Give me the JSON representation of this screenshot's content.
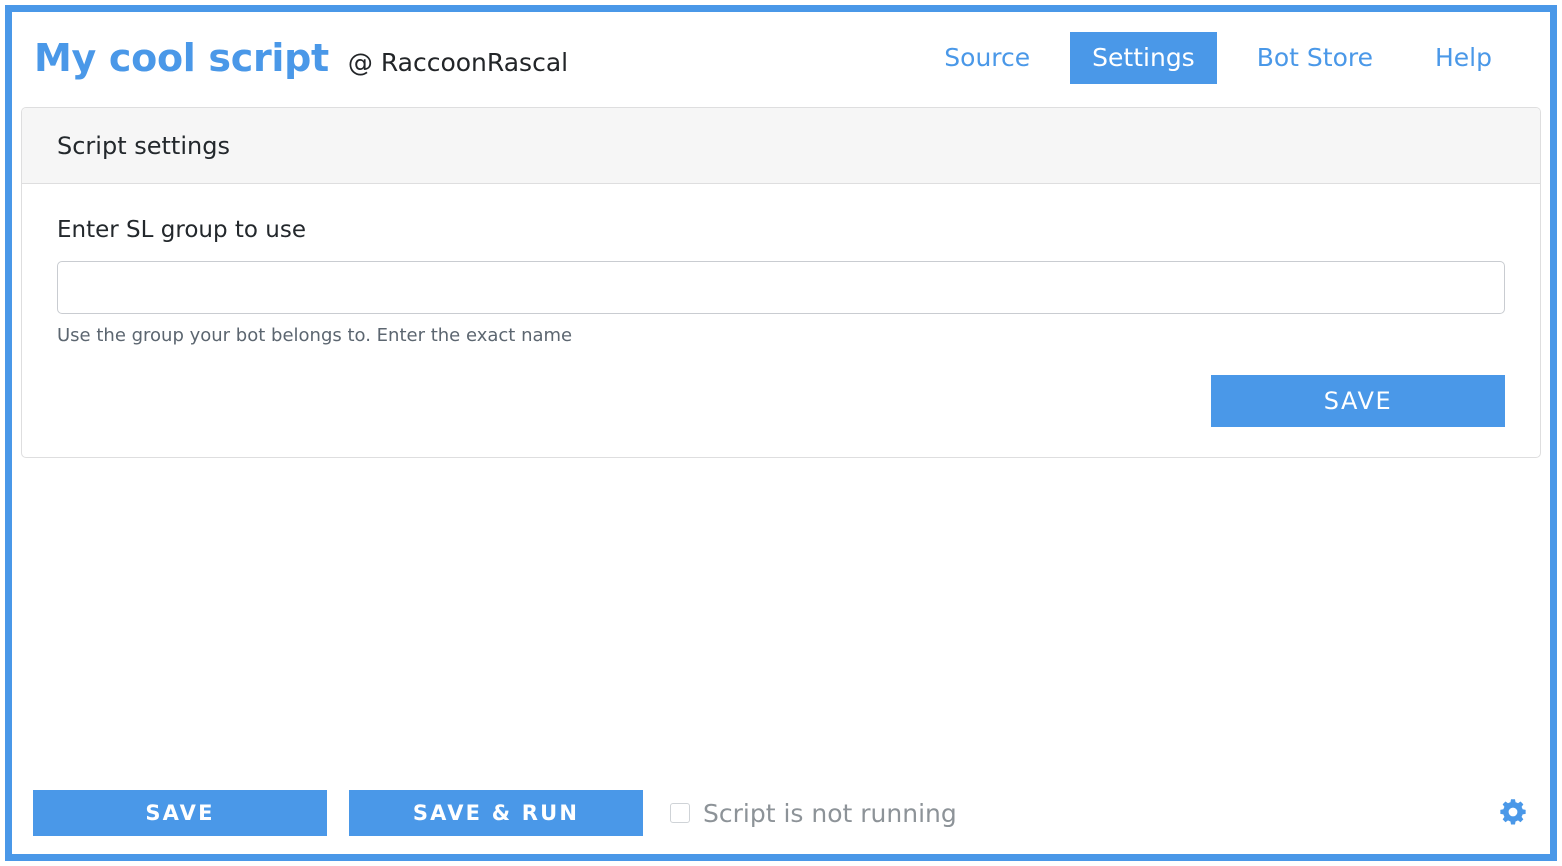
{
  "window": {
    "frame_color": "#4a98e8"
  },
  "header": {
    "script_title": "My cool script",
    "owner_handle": "@ RaccoonRascal",
    "nav": [
      {
        "label": "Source",
        "active": false
      },
      {
        "label": "Settings",
        "active": true
      },
      {
        "label": "Bot Store",
        "active": false
      },
      {
        "label": "Help",
        "active": false
      }
    ]
  },
  "card": {
    "header_title": "Script settings",
    "field": {
      "label": "Enter SL group to use",
      "value": "",
      "placeholder": "",
      "help_text": "Use the group your bot belongs to. Enter the exact name"
    },
    "save_label": "SAVE"
  },
  "footer": {
    "save_label": "SAVE",
    "save_run_label": "SAVE & RUN",
    "run_status_label": "Script is not running",
    "run_status_checked": false,
    "gear_icon": "gear-icon"
  },
  "colors": {
    "accent": "#4a98e8",
    "card_header_bg": "#f6f6f6",
    "card_border": "#dededf",
    "text_primary": "#23282c",
    "text_muted": "#5c6670",
    "status_text": "#8d9398"
  }
}
